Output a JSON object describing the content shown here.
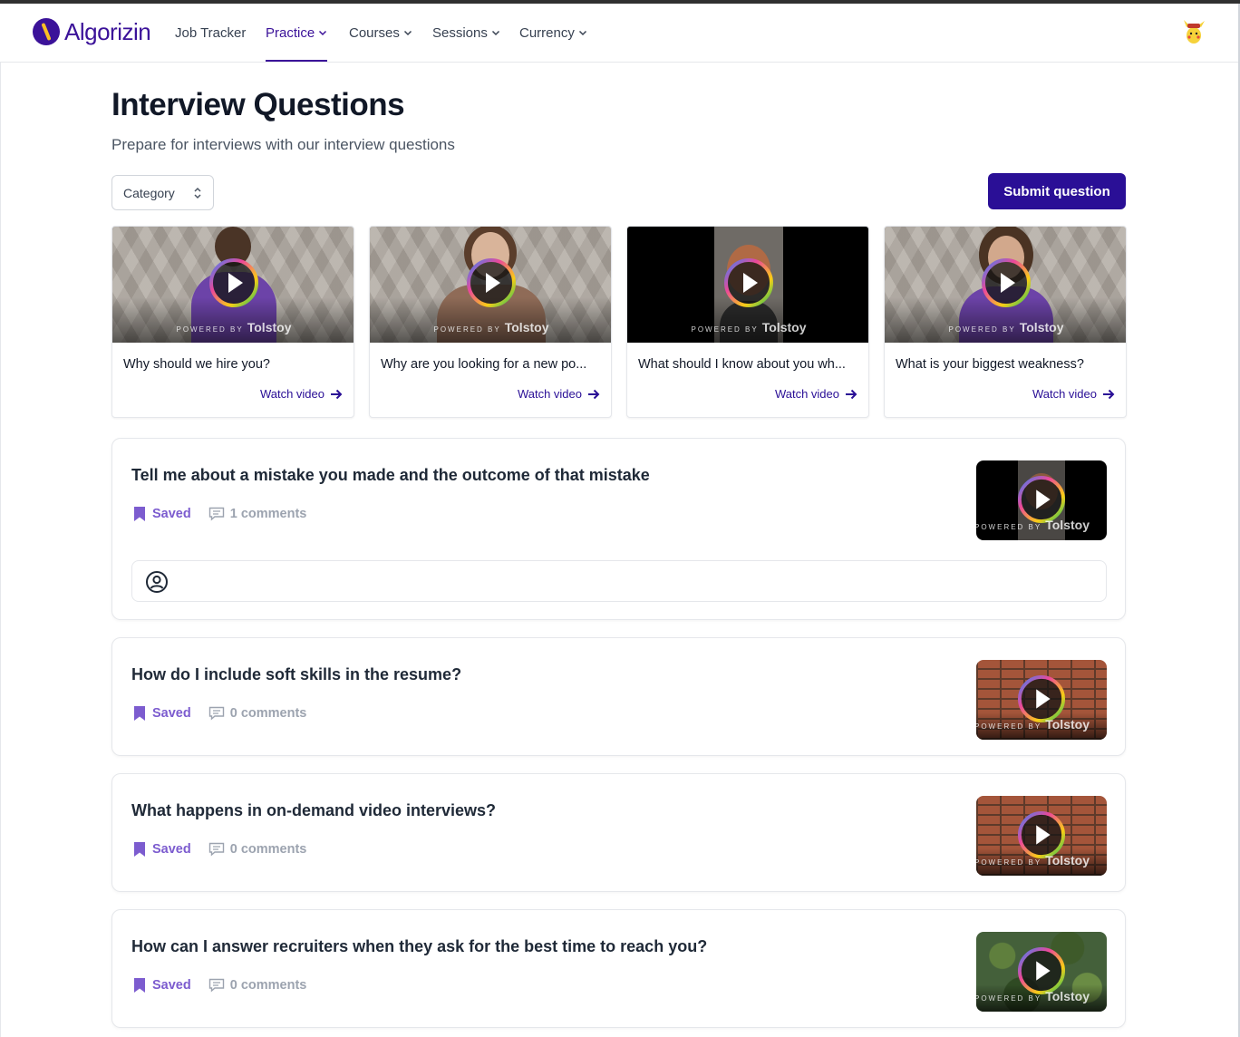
{
  "nav": {
    "logo": "Algorizin",
    "items": [
      {
        "label": "Job Tracker",
        "dropdown": false
      },
      {
        "label": "Practice",
        "dropdown": true,
        "active": true
      },
      {
        "label": "Courses",
        "dropdown": true
      },
      {
        "label": "Sessions",
        "dropdown": true
      },
      {
        "label": "Currency",
        "dropdown": true
      }
    ],
    "avatar_icon": "pikachu-avatar-icon"
  },
  "header": {
    "title": "Interview Questions",
    "subtitle": "Prepare for interviews with our interview questions",
    "category_label": "Category",
    "submit_label": "Submit question"
  },
  "video_cards": [
    {
      "title": "Why should we hire you?",
      "watch_label": "Watch video"
    },
    {
      "title": "Why are you looking for a new po...",
      "watch_label": "Watch video"
    },
    {
      "title": "What should I know about you wh...",
      "watch_label": "Watch video"
    },
    {
      "title": "What is your biggest weakness?",
      "watch_label": "Watch video"
    }
  ],
  "powered_by": {
    "prefix": "POWERED BY",
    "brand": "Tolstoy"
  },
  "questions": [
    {
      "title": "Tell me about a mistake you made and the outcome of that mistake",
      "saved_label": "Saved",
      "comments_label": "1 comments"
    },
    {
      "title": "How do I include soft skills in the resume?",
      "saved_label": "Saved",
      "comments_label": "0 comments"
    },
    {
      "title": "What happens in on-demand video interviews?",
      "saved_label": "Saved",
      "comments_label": "0 comments"
    },
    {
      "title": "How can I answer recruiters when they ask for the best time to reach you?",
      "saved_label": "Saved",
      "comments_label": "0 comments"
    }
  ],
  "colors": {
    "brand": "#3b1299",
    "button": "#2a0f96",
    "saved": "#7c5ccf",
    "muted": "#9ca3af"
  }
}
